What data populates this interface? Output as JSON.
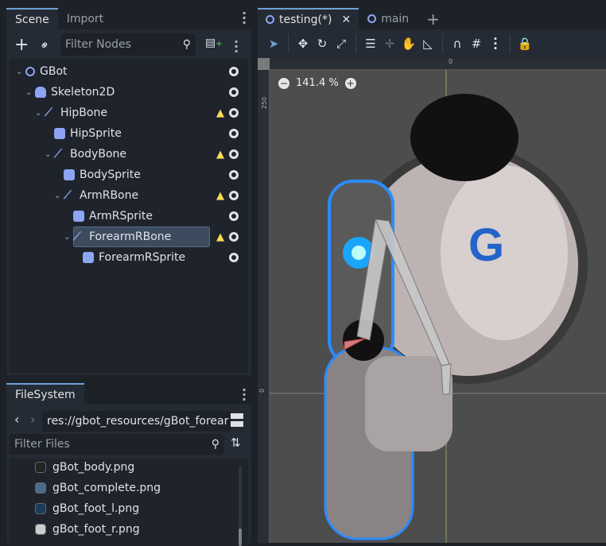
{
  "scene_dock": {
    "tabs": [
      "Scene",
      "Import"
    ],
    "filter_placeholder": "Filter Nodes",
    "nodes": [
      {
        "name": "GBot",
        "depth": 0,
        "icon": "node2d-circle-icon",
        "warning": false,
        "selected": false
      },
      {
        "name": "Skeleton2D",
        "depth": 1,
        "icon": "skeleton-icon",
        "warning": false,
        "selected": false
      },
      {
        "name": "HipBone",
        "depth": 2,
        "icon": "bone-icon",
        "warning": true,
        "selected": false
      },
      {
        "name": "HipSprite",
        "depth": 3,
        "icon": "sprite-icon",
        "warning": false,
        "selected": false
      },
      {
        "name": "BodyBone",
        "depth": 3,
        "icon": "bone-icon",
        "warning": true,
        "selected": false
      },
      {
        "name": "BodySprite",
        "depth": 4,
        "icon": "sprite-icon",
        "warning": false,
        "selected": false
      },
      {
        "name": "ArmRBone",
        "depth": 4,
        "icon": "bone-icon",
        "warning": true,
        "selected": false
      },
      {
        "name": "ArmRSprite",
        "depth": 5,
        "icon": "sprite-icon",
        "warning": false,
        "selected": false
      },
      {
        "name": "ForearmRBone",
        "depth": 5,
        "icon": "bone-icon",
        "warning": true,
        "selected": true
      },
      {
        "name": "ForearmRSprite",
        "depth": 6,
        "icon": "sprite-icon",
        "warning": false,
        "selected": false
      }
    ]
  },
  "filesystem": {
    "tab": "FileSystem",
    "path": "res://gbot_resources/gBot_forear",
    "filter_placeholder": "Filter Files",
    "files": [
      "gBot_body.png",
      "gBot_complete.png",
      "gBot_foot_l.png",
      "gBot_foot_r.png"
    ]
  },
  "editor": {
    "tabs": [
      {
        "label": "testing(*)",
        "active": true
      },
      {
        "label": "main",
        "active": false
      }
    ],
    "zoom": "141.4 %",
    "ruler_labels": {
      "top_zero": "0",
      "left_250": "250",
      "left_zero": "0"
    },
    "logo_letter": "G"
  },
  "colors": {
    "accent": "#6ea0d6",
    "warning": "#ffdd55",
    "canvas": "#4d4d4d",
    "selected": "#3c4b5e"
  }
}
